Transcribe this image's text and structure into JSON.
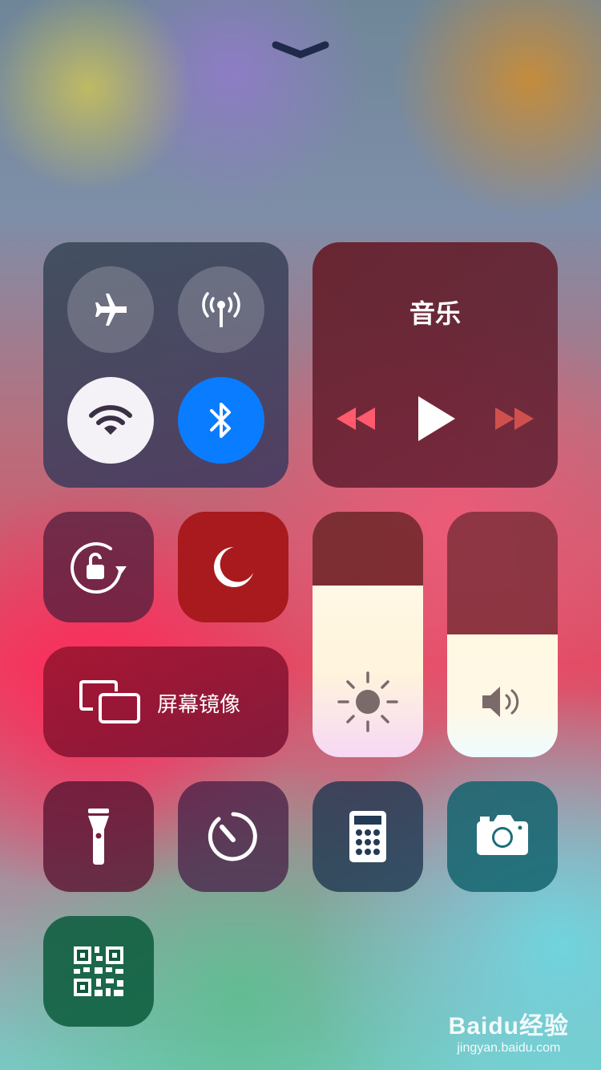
{
  "connectivity": {
    "airplane_icon": "airplane-icon",
    "cellular_icon": "antenna-icon",
    "wifi_icon": "wifi-icon",
    "bluetooth_icon": "bluetooth-icon",
    "accent_bluetooth": "#0a7cff"
  },
  "music": {
    "title": "音乐",
    "accent": "#e24a63"
  },
  "screen_mirroring": {
    "label": "屏幕镜像"
  },
  "sliders": {
    "brightness_level": 0.7,
    "volume_level": 0.5
  },
  "watermark": {
    "brand": "Baidu经验",
    "url": "jingyan.baidu.com"
  }
}
